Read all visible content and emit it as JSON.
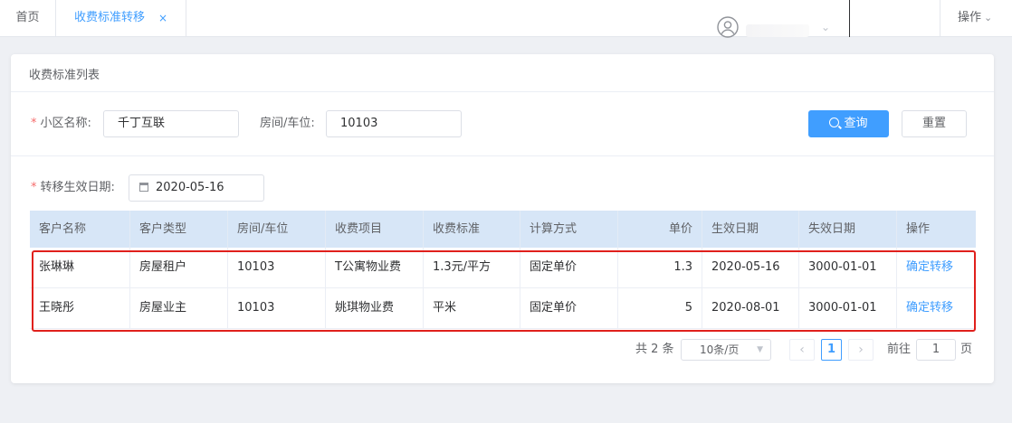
{
  "tabs": {
    "home_label": "首页",
    "active_label": "收费标准转移",
    "close_glyph": "×"
  },
  "header": {
    "operations_label": "操作",
    "caret_glyph": "⌄"
  },
  "card": {
    "title": "收费标准列表"
  },
  "form": {
    "community_label": "小区名称:",
    "community_value": "千丁互联",
    "room_label": "房间/车位:",
    "room_value": "10103",
    "date_label": "转移生效日期:",
    "date_value": "2020-05-16",
    "required_mark": "*",
    "search_button": "查询",
    "reset_button": "重置"
  },
  "table": {
    "headers": [
      "客户名称",
      "客户类型",
      "房间/车位",
      "收费项目",
      "收费标准",
      "计算方式",
      "单价",
      "生效日期",
      "失效日期",
      "操作"
    ],
    "rows": [
      [
        "张琳琳",
        "房屋租户",
        "10103",
        "T公寓物业费",
        "1.3元/平方",
        "固定单价",
        "1.3",
        "2020-05-16",
        "3000-01-01",
        "确定转移"
      ],
      [
        "王晓彤",
        "房屋业主",
        "10103",
        "姚琪物业费",
        "平米",
        "固定单价",
        "5",
        "2020-08-01",
        "3000-01-01",
        "确定转移"
      ]
    ]
  },
  "pagination": {
    "total_text": "共 2 条",
    "page_size": "10条/页",
    "prev_glyph": "‹",
    "next_glyph": "›",
    "current_page": "1",
    "goto_label": "前往",
    "goto_value": "1",
    "page_suffix": "页"
  },
  "colors": {
    "accent": "#409eff",
    "highlight_border": "#e0201c",
    "table_header_bg": "#d7e6f7"
  }
}
